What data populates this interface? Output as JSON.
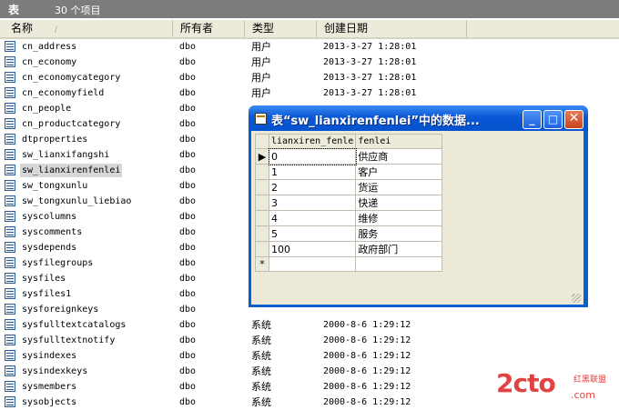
{
  "header": {
    "title": "表",
    "count": "30 个项目"
  },
  "columns": {
    "name": "名称",
    "sort_glyph": "/",
    "owner": "所有者",
    "type": "类型",
    "date": "创建日期"
  },
  "rows": [
    {
      "name": "cn_address",
      "owner": "dbo",
      "type": "用户",
      "date": "2013-3-27 1:28:01"
    },
    {
      "name": "cn_economy",
      "owner": "dbo",
      "type": "用户",
      "date": "2013-3-27 1:28:01"
    },
    {
      "name": "cn_economycategory",
      "owner": "dbo",
      "type": "用户",
      "date": "2013-3-27 1:28:01"
    },
    {
      "name": "cn_economyfield",
      "owner": "dbo",
      "type": "用户",
      "date": "2013-3-27 1:28:01"
    },
    {
      "name": "cn_people",
      "owner": "dbo",
      "type": "",
      "date": ""
    },
    {
      "name": "cn_productcategory",
      "owner": "dbo",
      "type": "",
      "date": ""
    },
    {
      "name": "dtproperties",
      "owner": "dbo",
      "type": "",
      "date": ""
    },
    {
      "name": "sw_lianxifangshi",
      "owner": "dbo",
      "type": "",
      "date": ""
    },
    {
      "name": "sw_lianxirenfenlei",
      "owner": "dbo",
      "type": "",
      "date": ""
    },
    {
      "name": "sw_tongxunlu",
      "owner": "dbo",
      "type": "",
      "date": ""
    },
    {
      "name": "sw_tongxunlu_liebiao",
      "owner": "dbo",
      "type": "",
      "date": ""
    },
    {
      "name": "syscolumns",
      "owner": "dbo",
      "type": "",
      "date": ""
    },
    {
      "name": "syscomments",
      "owner": "dbo",
      "type": "",
      "date": ""
    },
    {
      "name": "sysdepends",
      "owner": "dbo",
      "type": "",
      "date": ""
    },
    {
      "name": "sysfilegroups",
      "owner": "dbo",
      "type": "",
      "date": ""
    },
    {
      "name": "sysfiles",
      "owner": "dbo",
      "type": "",
      "date": ""
    },
    {
      "name": "sysfiles1",
      "owner": "dbo",
      "type": "",
      "date": ""
    },
    {
      "name": "sysforeignkeys",
      "owner": "dbo",
      "type": "",
      "date": ""
    },
    {
      "name": "sysfulltextcatalogs",
      "owner": "dbo",
      "type": "系统",
      "date": "2000-8-6 1:29:12"
    },
    {
      "name": "sysfulltextnotify",
      "owner": "dbo",
      "type": "系统",
      "date": "2000-8-6 1:29:12"
    },
    {
      "name": "sysindexes",
      "owner": "dbo",
      "type": "系统",
      "date": "2000-8-6 1:29:12"
    },
    {
      "name": "sysindexkeys",
      "owner": "dbo",
      "type": "系统",
      "date": "2000-8-6 1:29:12"
    },
    {
      "name": "sysmembers",
      "owner": "dbo",
      "type": "系统",
      "date": "2000-8-6 1:29:12"
    },
    {
      "name": "sysobjects",
      "owner": "dbo",
      "type": "系统",
      "date": "2000-8-6 1:29:12"
    }
  ],
  "selected_row_index": 8,
  "dialog": {
    "title": "表“sw_lianxirenfenlei”中的数据...",
    "buttons": {
      "minimize": "_",
      "maximize": "□",
      "close": "✕"
    },
    "col1": "lianxiren_fenle",
    "col2": "fenlei",
    "row_marker": "▶",
    "new_row_marker": "*",
    "data_rows": [
      {
        "c1": "0",
        "c2": "供应商"
      },
      {
        "c1": "1",
        "c2": "客户"
      },
      {
        "c1": "2",
        "c2": "货运"
      },
      {
        "c1": "3",
        "c2": "快递"
      },
      {
        "c1": "4",
        "c2": "维修"
      },
      {
        "c1": "5",
        "c2": "服务"
      },
      {
        "c1": "100",
        "c2": "政府部门"
      }
    ]
  },
  "watermark": {
    "main": "2cto",
    "sub": "红黑联盟",
    "dot": ".com"
  },
  "colors": {
    "topbar": "#7c7c7c",
    "titlebar": "#0a58d5",
    "close": "#c8431f",
    "watermark": "#dd2222"
  }
}
